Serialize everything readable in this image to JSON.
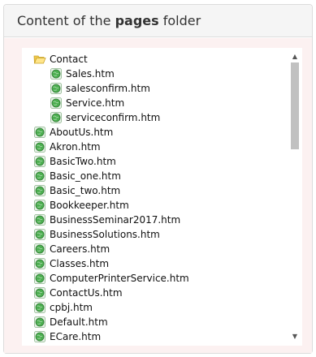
{
  "header": {
    "prefix": "Content of the ",
    "bold": "pages",
    "suffix": " folder"
  },
  "tree": {
    "folder": {
      "label": "Contact",
      "icon": "open-folder-icon"
    },
    "folder_children": [
      "Sales.htm",
      "salesconfirm.htm",
      "Service.htm",
      "serviceconfirm.htm"
    ],
    "files": [
      "AboutUs.htm",
      "Akron.htm",
      "BasicTwo.htm",
      "Basic_one.htm",
      "Basic_two.htm",
      "Bookkeeper.htm",
      "BusinessSeminar2017.htm",
      "BusinessSolutions.htm",
      "Careers.htm",
      "Classes.htm",
      "ComputerPrinterService.htm",
      "ContactUs.htm",
      "cpbj.htm",
      "Default.htm",
      "ECare.htm"
    ],
    "file_icon": "web-page-globe-icon"
  },
  "scrollbar": {
    "up_icon": "scroll-up-arrow-icon",
    "down_icon": "scroll-down-arrow-icon",
    "up_glyph": "▲",
    "down_glyph": "▼"
  },
  "colors": {
    "panel_body": "#fcf1f1",
    "header_bg": "#f5f5f5",
    "folder": "#f2c94c",
    "globe": "#4caf50"
  }
}
